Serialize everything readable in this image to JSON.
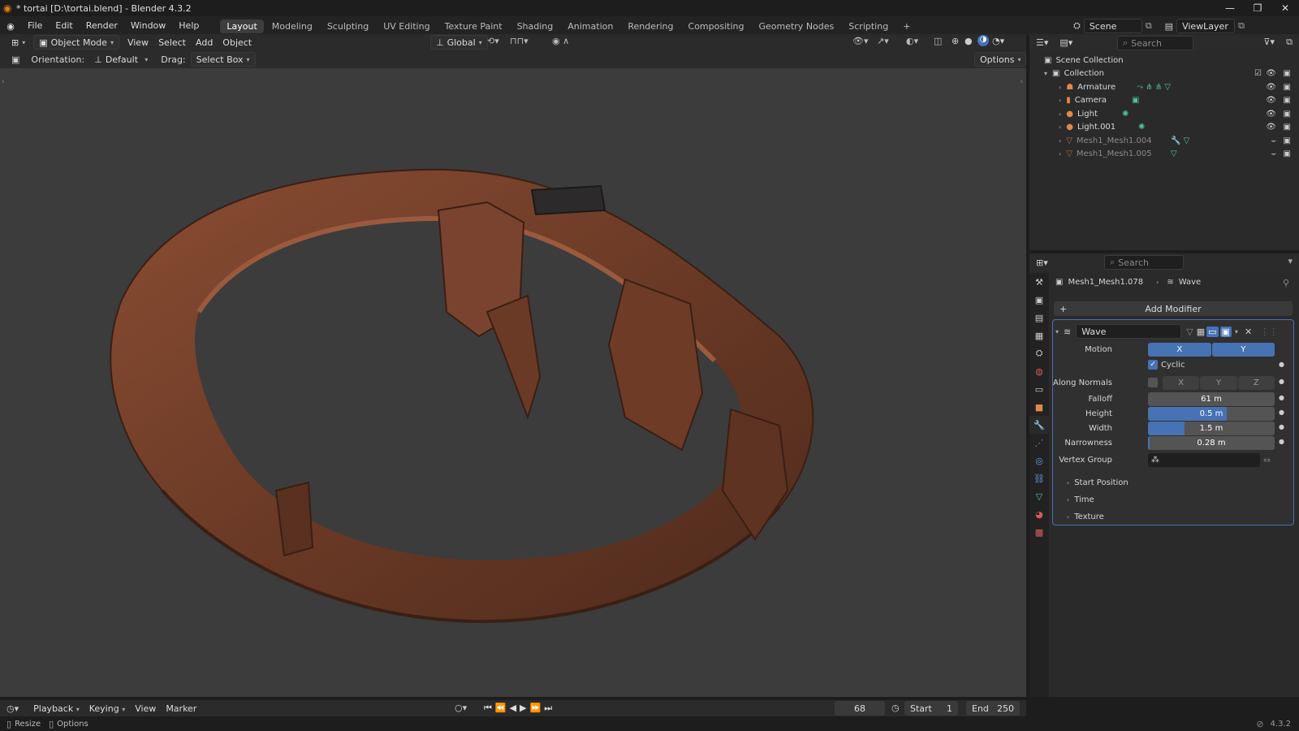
{
  "window": {
    "title": "* tortai [D:\\tortai.blend] - Blender 4.3.2"
  },
  "menu": [
    "File",
    "Edit",
    "Render",
    "Window",
    "Help"
  ],
  "workspaces": [
    "Layout",
    "Modeling",
    "Sculpting",
    "UV Editing",
    "Texture Paint",
    "Shading",
    "Animation",
    "Rendering",
    "Compositing",
    "Geometry Nodes",
    "Scripting"
  ],
  "scene": {
    "label": "Scene",
    "view_layer": "ViewLayer"
  },
  "viewport_header": {
    "mode": "Object Mode",
    "menus": [
      "View",
      "Select",
      "Add",
      "Object"
    ],
    "transform_orientation": "Global",
    "tool_orientation_label": "Orientation:",
    "tool_orientation_value": "Default",
    "drag_label": "Drag:",
    "drag_value": "Select Box",
    "options": "Options"
  },
  "outliner": {
    "search_placeholder": "Search",
    "root": "Scene Collection",
    "collection": "Collection",
    "items": [
      {
        "name": "Armature",
        "dim": false
      },
      {
        "name": "Camera",
        "dim": false
      },
      {
        "name": "Light",
        "dim": false
      },
      {
        "name": "Light.001",
        "dim": false
      },
      {
        "name": "Mesh1_Mesh1.004",
        "dim": true
      },
      {
        "name": "Mesh1_Mesh1.005",
        "dim": true
      }
    ]
  },
  "properties": {
    "search_placeholder": "Search",
    "object": "Mesh1_Mesh1.078",
    "modifier_crumb": "Wave",
    "add_modifier": "Add Modifier",
    "modifier_name": "Wave",
    "motion_label": "Motion",
    "motion_x": "X",
    "motion_y": "Y",
    "cyclic_label": "Cyclic",
    "cyclic_checked": true,
    "along_normals_label": "Along Normals",
    "normals_x": "X",
    "normals_y": "Y",
    "normals_z": "Z",
    "falloff_label": "Falloff",
    "falloff_value": "61 m",
    "height_label": "Height",
    "height_value": "0.5 m",
    "height_fill": 0.62,
    "width_label": "Width",
    "width_value": "1.5 m",
    "width_fill": 0.29,
    "narrowness_label": "Narrowness",
    "narrowness_value": "0.28 m",
    "narrowness_fill": 0.01,
    "vertex_group_label": "Vertex Group",
    "panels": [
      "Start Position",
      "Time",
      "Texture"
    ]
  },
  "timeline": {
    "menus": [
      "Playback",
      "Keying",
      "View",
      "Marker"
    ],
    "current_frame": "68",
    "start_label": "Start",
    "start_value": "1",
    "end_label": "End",
    "end_value": "250"
  },
  "status": {
    "resize": "Resize",
    "options": "Options",
    "version": "4.3.2"
  },
  "colors": {
    "accent": "#4772b3",
    "viewport_bg": "#3c3c3c",
    "leather": "#6b3a26"
  }
}
